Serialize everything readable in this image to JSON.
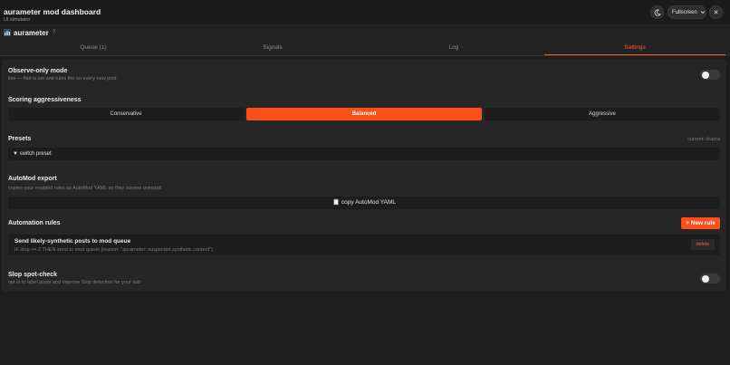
{
  "window": {
    "title": "aurameter mod dashboard",
    "subtitle": "UI simulator",
    "fullscreen_label": "Fullscreen",
    "close_glyph": "✕"
  },
  "header": {
    "brand": "aurameter",
    "help": "?"
  },
  "tabs": [
    {
      "label": "Queue (1)",
      "active": false
    },
    {
      "label": "Signals",
      "active": false
    },
    {
      "label": "Log",
      "active": false
    },
    {
      "label": "Settings",
      "active": true
    }
  ],
  "settings": {
    "observe": {
      "title": "Observe-only mode",
      "desc": "live — flair is set and rules fire on every new post",
      "enabled": false
    },
    "scoring": {
      "title": "Scoring aggressiveness",
      "options": [
        "Conservative",
        "Balanced",
        "Aggressive"
      ],
      "selected": "Balanced"
    },
    "presets": {
      "title": "Presets",
      "current": "current: drama",
      "select_label": "▼ switch preset"
    },
    "automod": {
      "title": "AutoMod export",
      "desc": "copies your enabled rules as AutoMod YAML so they survive uninstall",
      "button_label": "📋 copy AutoMod YAML"
    },
    "rules": {
      "title": "Automation rules",
      "new_label": "+ New rule",
      "items": [
        {
          "title": "Send likely-synthetic posts to mod queue",
          "desc": "IF slop >= 2 THEN send to mod queue (reason: \"aurameter: suspected synthetic content\")",
          "delete_label": "delete"
        }
      ]
    },
    "slop": {
      "title": "Slop spot-check",
      "desc": "opt in to label posts and improve Slop detection for your sub",
      "enabled": false
    }
  },
  "colors": {
    "accent": "#ff4f19",
    "background": "#1e1e1f",
    "panel": "#262627"
  }
}
